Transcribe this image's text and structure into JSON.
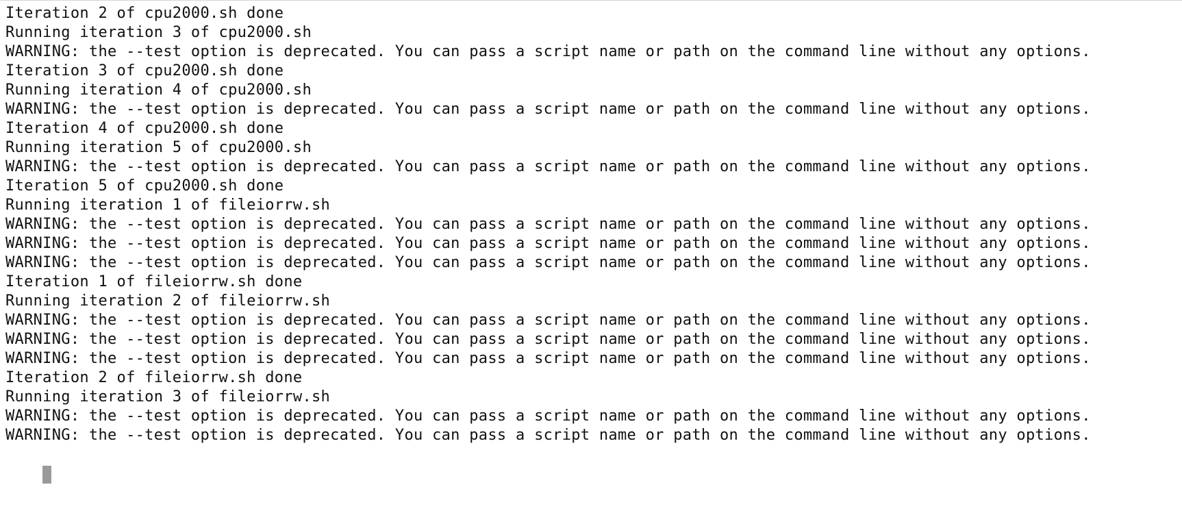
{
  "terminal": {
    "lines": [
      "Iteration 2 of cpu2000.sh done",
      "Running iteration 3 of cpu2000.sh",
      "WARNING: the --test option is deprecated. You can pass a script name or path on the command line without any options.",
      "Iteration 3 of cpu2000.sh done",
      "Running iteration 4 of cpu2000.sh",
      "WARNING: the --test option is deprecated. You can pass a script name or path on the command line without any options.",
      "Iteration 4 of cpu2000.sh done",
      "Running iteration 5 of cpu2000.sh",
      "WARNING: the --test option is deprecated. You can pass a script name or path on the command line without any options.",
      "Iteration 5 of cpu2000.sh done",
      "Running iteration 1 of fileiorrw.sh",
      "WARNING: the --test option is deprecated. You can pass a script name or path on the command line without any options.",
      "WARNING: the --test option is deprecated. You can pass a script name or path on the command line without any options.",
      "WARNING: the --test option is deprecated. You can pass a script name or path on the command line without any options.",
      "Iteration 1 of fileiorrw.sh done",
      "Running iteration 2 of fileiorrw.sh",
      "WARNING: the --test option is deprecated. You can pass a script name or path on the command line without any options.",
      "WARNING: the --test option is deprecated. You can pass a script name or path on the command line without any options.",
      "WARNING: the --test option is deprecated. You can pass a script name or path on the command line without any options.",
      "Iteration 2 of fileiorrw.sh done",
      "Running iteration 3 of fileiorrw.sh",
      "WARNING: the --test option is deprecated. You can pass a script name or path on the command line without any options.",
      "WARNING: the --test option is deprecated. You can pass a script name or path on the command line without any options."
    ],
    "colors": {
      "background": "#ffffff",
      "text": "#111111",
      "cursor": "#9a9a9a"
    }
  }
}
